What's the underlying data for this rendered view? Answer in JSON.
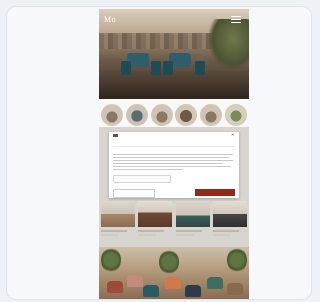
{
  "site": {
    "brand_text": "Mo"
  },
  "consent": {
    "tabs": [
      "",
      "",
      "",
      ""
    ],
    "title": "",
    "deny_label": "",
    "mid_label": "",
    "accept_label": ""
  },
  "colors": {
    "accent": "#8e2b1c",
    "accent_text": "#b34b3a",
    "page_bg": "#faf8f5",
    "frame_bg": "#eef1f6"
  },
  "icons": {
    "menu": "hamburger-menu-icon",
    "close": "close-icon",
    "logo": "site-logo-icon"
  }
}
